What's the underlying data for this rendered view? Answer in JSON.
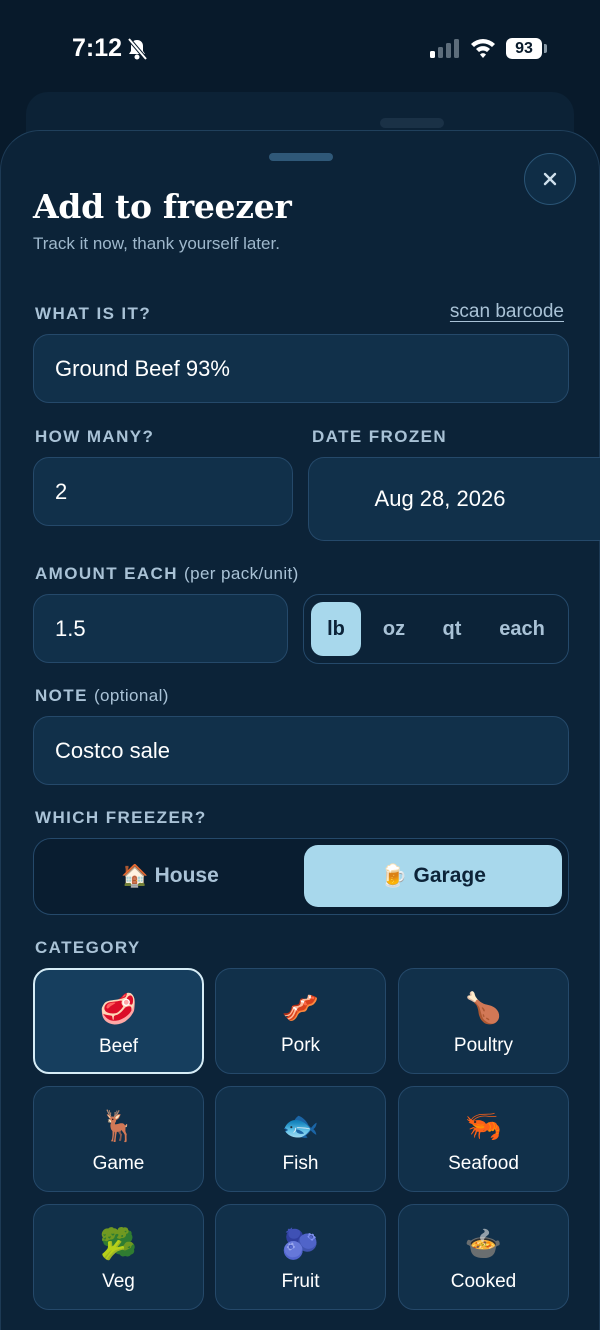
{
  "status": {
    "time": "7:12",
    "battery": "93"
  },
  "sheet": {
    "title": "Add to freezer",
    "subtitle": "Track it now, thank yourself later.",
    "close_icon": "close-icon"
  },
  "form": {
    "what_label": "WHAT IS IT?",
    "scan_link": "scan barcode",
    "name_value": "Ground Beef 93%",
    "how_many_label": "HOW MANY?",
    "how_many_value": "2",
    "date_label": "DATE FROZEN",
    "date_value": "Aug 28, 2026",
    "amount_label": "AMOUNT EACH",
    "amount_sub": "(per pack/unit)",
    "amount_value": "1.5",
    "units": [
      "lb",
      "oz",
      "qt",
      "each"
    ],
    "selected_unit": "lb",
    "note_label": "NOTE",
    "note_sub": "(optional)",
    "note_value": "Costco sale",
    "freezer_label": "WHICH FREEZER?",
    "freezers": [
      {
        "emoji": "🏠",
        "label": "House"
      },
      {
        "emoji": "🍺",
        "label": "Garage"
      }
    ],
    "selected_freezer": "Garage",
    "category_label": "CATEGORY",
    "categories": [
      {
        "emoji": "🥩",
        "label": "Beef"
      },
      {
        "emoji": "🥓",
        "label": "Pork"
      },
      {
        "emoji": "🍗",
        "label": "Poultry"
      },
      {
        "emoji": "🦌",
        "label": "Game"
      },
      {
        "emoji": "🐟",
        "label": "Fish"
      },
      {
        "emoji": "🦐",
        "label": "Seafood"
      },
      {
        "emoji": "🥦",
        "label": "Veg"
      },
      {
        "emoji": "🫐",
        "label": "Fruit"
      },
      {
        "emoji": "🍲",
        "label": "Cooked"
      }
    ],
    "selected_category": "Beef"
  },
  "colors": {
    "background": "#081a2b",
    "sheet": "#0c2338",
    "accent": "#a8d8ec"
  }
}
